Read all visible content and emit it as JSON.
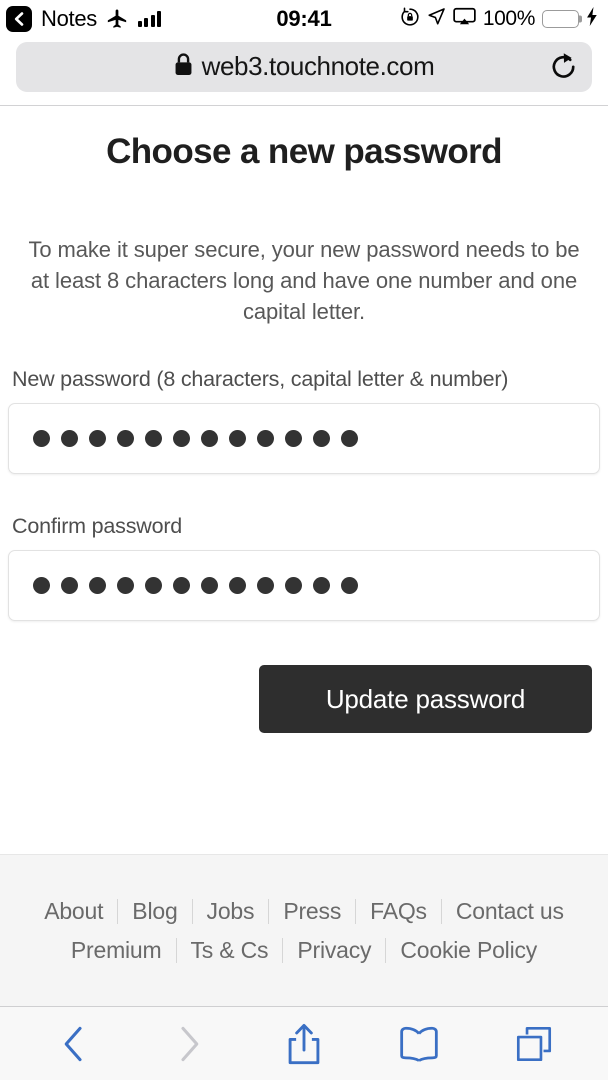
{
  "status_bar": {
    "back_app_label": "Notes",
    "back_icon": "chevron-left-icon",
    "airplane_icon": "airplane-mode-icon",
    "signal_icon": "cellular-signal-icon",
    "time": "09:41",
    "rotation_lock_icon": "rotation-lock-icon",
    "location_icon": "location-arrow-icon",
    "airplay_icon": "screen-mirroring-icon",
    "battery_percent": "100%",
    "battery_icon": "battery-full-icon",
    "charging_icon": "charging-bolt-icon",
    "battery_color": "#4cd964"
  },
  "browser": {
    "lock_icon": "lock-icon",
    "url": "web3.touchnote.com",
    "reload_icon": "reload-icon"
  },
  "page": {
    "title": "Choose a new password",
    "intro": "To make it super secure, your new password needs to be at least 8 characters long and have one number and one capital letter.",
    "fields": [
      {
        "label": "New password (8 characters, capital letter & number)",
        "masked_char_count": 12,
        "value_masked": "••••••••••••",
        "placeholder": ""
      },
      {
        "label": "Confirm password",
        "masked_char_count": 12,
        "value_masked": "••••••••••••",
        "placeholder": ""
      }
    ],
    "submit_label": "Update password",
    "submit_color": "#2e2e2e"
  },
  "footer": {
    "rows": [
      [
        "About",
        "Blog",
        "Jobs",
        "Press",
        "FAQs",
        "Contact us"
      ],
      [
        "Premium",
        "Ts & Cs",
        "Privacy",
        "Cookie Policy"
      ]
    ]
  },
  "toolbar": {
    "back_icon": "chevron-left-icon",
    "forward_icon": "chevron-right-icon",
    "share_icon": "share-icon",
    "bookmarks_icon": "book-icon",
    "tabs_icon": "tabs-icon",
    "active_color": "#3a6fc4",
    "disabled_color": "#c7c7cc"
  }
}
